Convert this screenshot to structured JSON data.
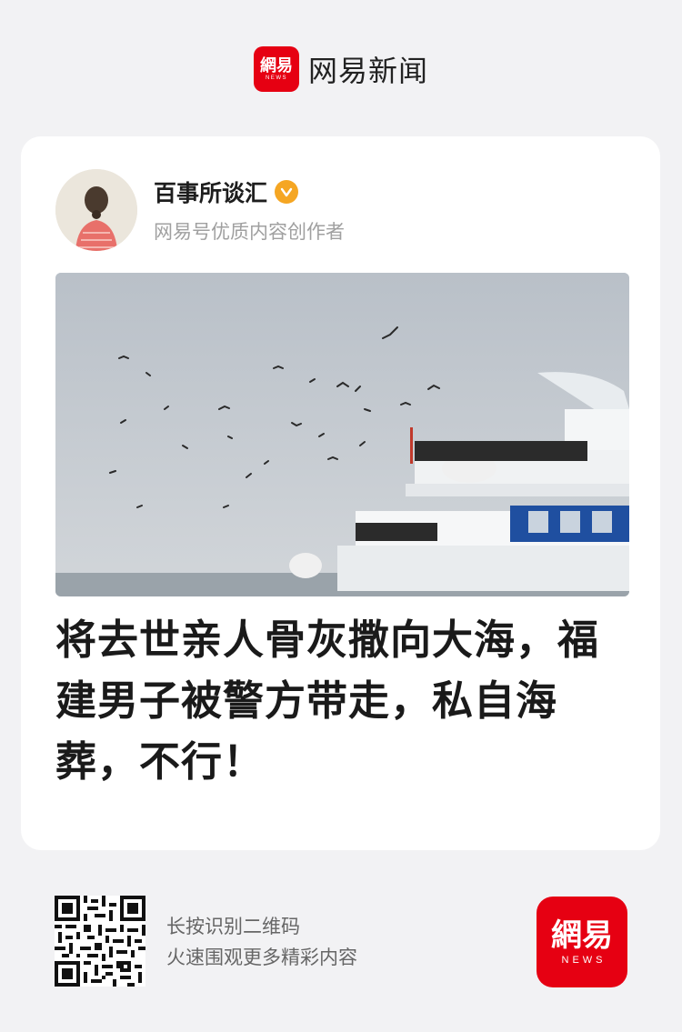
{
  "header": {
    "logo_zh": "網易",
    "logo_en": "NEWS",
    "app_name": "网易新闻"
  },
  "author": {
    "name": "百事所谈汇",
    "description": "网易号优质内容创作者"
  },
  "article": {
    "title": "将去世亲人骨灰撒向大海，福建男子被警方带走，私自海葬，不行！"
  },
  "footer": {
    "qr_line1": "长按识别二维码",
    "qr_line2": "火速围观更多精彩内容",
    "logo_zh": "網易",
    "logo_en": "NEWS"
  },
  "colors": {
    "brand_red": "#e60012",
    "verified_badge": "#f5a623",
    "background": "#f2f2f4"
  },
  "icons": {
    "verified": "verified-check-icon",
    "qr": "qr-code-icon"
  }
}
